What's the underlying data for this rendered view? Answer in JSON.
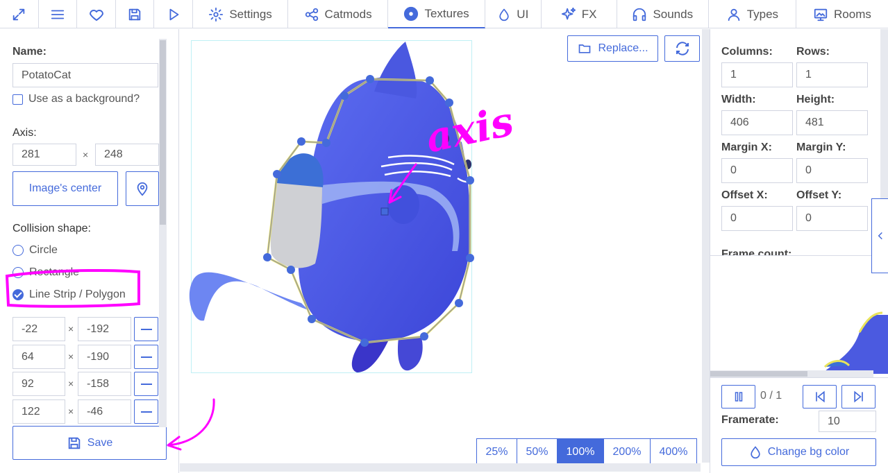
{
  "toolbar": {
    "tabs": [
      {
        "label": "Settings",
        "icon": "gear-icon"
      },
      {
        "label": "Catmods",
        "icon": "nodes-icon"
      },
      {
        "label": "Textures",
        "icon": "compass-icon"
      },
      {
        "label": "UI",
        "icon": "drop-icon"
      },
      {
        "label": "FX",
        "icon": "sparkle-icon"
      },
      {
        "label": "Sounds",
        "icon": "headphones-icon"
      },
      {
        "label": "Types",
        "icon": "user-icon"
      },
      {
        "label": "Rooms",
        "icon": "monitor-icon"
      }
    ]
  },
  "left": {
    "name_label": "Name:",
    "name_value": "PotatoCat",
    "background_label": "Use as a background?",
    "axis_label": "Axis:",
    "axis_x": "281",
    "axis_y": "248",
    "axis_sep": "×",
    "center_button": "Image's center",
    "collision_label": "Collision shape:",
    "shapes": [
      "Circle",
      "Rectangle",
      "Line Strip / Polygon"
    ],
    "points": [
      {
        "x": "-22",
        "y": "-192"
      },
      {
        "x": "64",
        "y": "-190"
      },
      {
        "x": "92",
        "y": "-158"
      },
      {
        "x": "122",
        "y": "-46"
      }
    ],
    "save_label": "Save"
  },
  "center": {
    "replace_label": "Replace...",
    "annotation_text": "axis",
    "zoom_levels": [
      "25%",
      "50%",
      "100%",
      "200%",
      "400%"
    ],
    "zoom_selected": "100%"
  },
  "right": {
    "columns_label": "Columns:",
    "columns_value": "1",
    "rows_label": "Rows:",
    "rows_value": "1",
    "width_label": "Width:",
    "width_value": "406",
    "height_label": "Height:",
    "height_value": "481",
    "margin_x_label": "Margin X:",
    "margin_x_value": "0",
    "margin_y_label": "Margin Y:",
    "margin_y_value": "0",
    "offset_x_label": "Offset X:",
    "offset_x_value": "0",
    "offset_y_label": "Offset Y:",
    "offset_y_value": "0",
    "frame_count_label": "Frame count:",
    "frame_counter": "0 / 1",
    "framerate_label": "Framerate:",
    "framerate_value": "10",
    "bg_color_label": "Change bg color"
  },
  "colors": {
    "accent": "#446adb",
    "highlight": "#ff00ff",
    "sprite_body": "#4b5ae0"
  }
}
